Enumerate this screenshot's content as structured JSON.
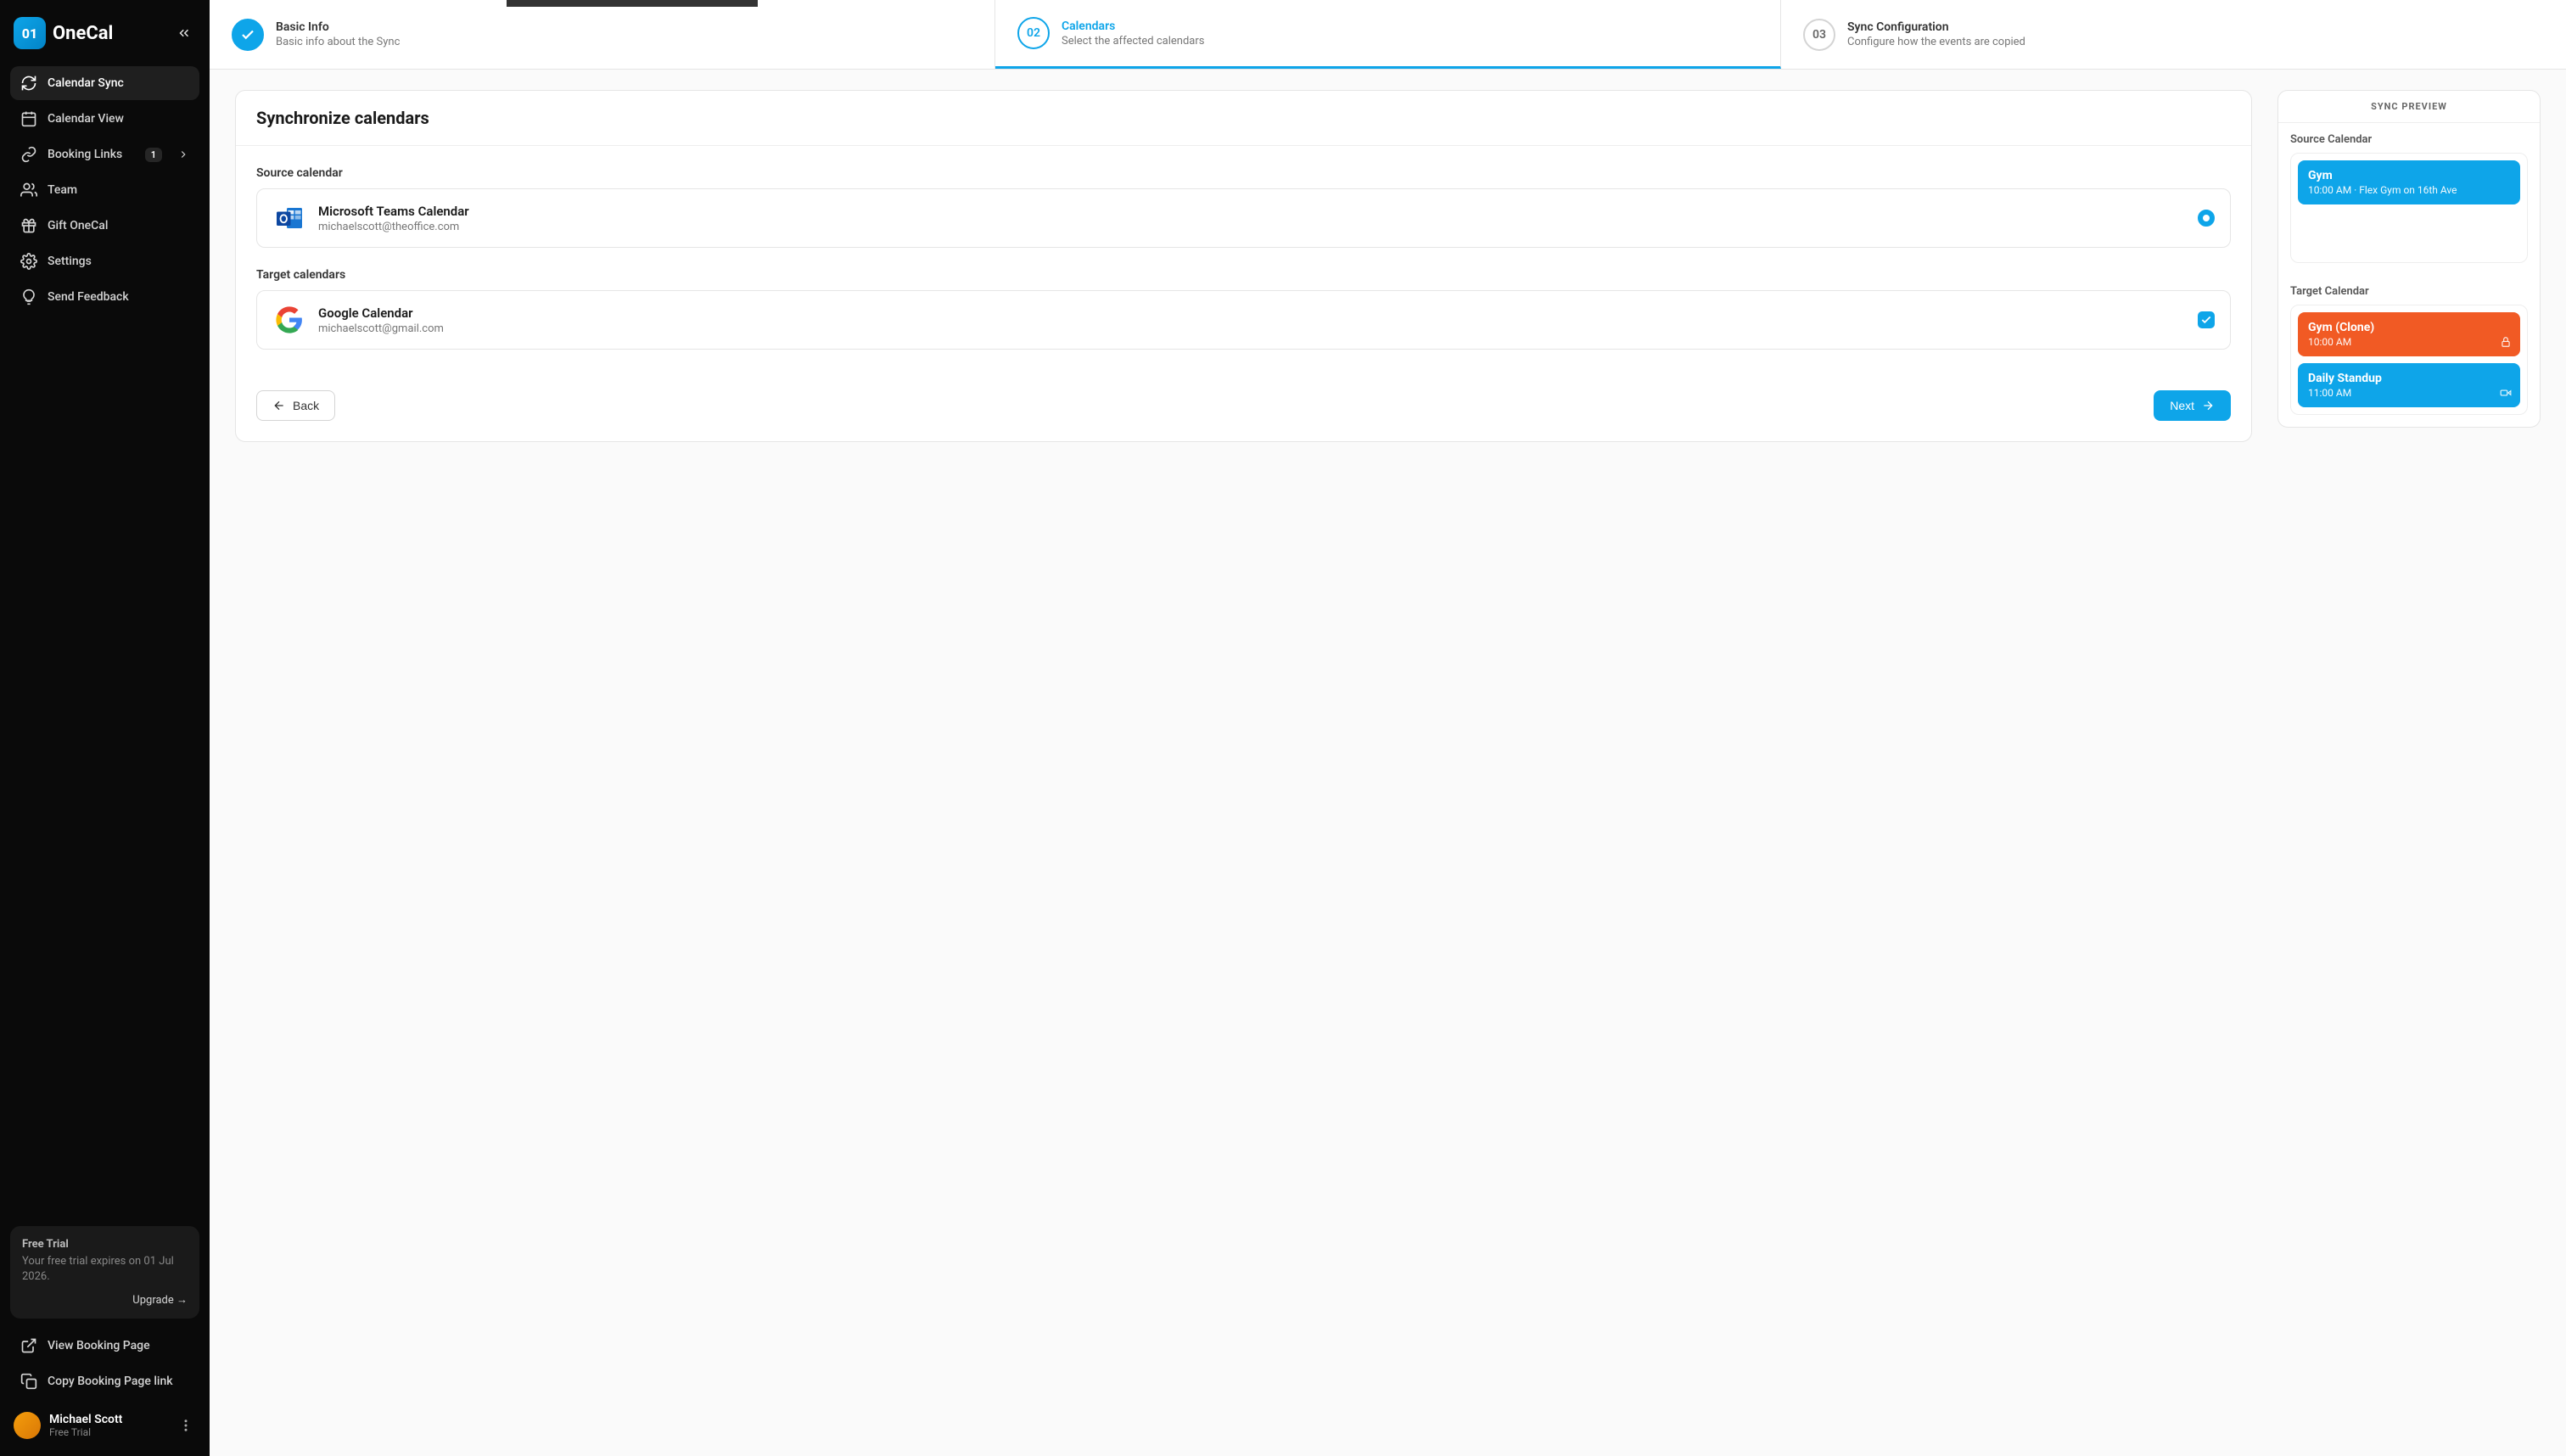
{
  "brand": {
    "badge": "01",
    "name": "OneCal"
  },
  "sidebar": {
    "items": [
      {
        "label": "Calendar Sync"
      },
      {
        "label": "Calendar View"
      },
      {
        "label": "Booking Links",
        "badge": "1"
      },
      {
        "label": "Team"
      },
      {
        "label": "Gift OneCal"
      },
      {
        "label": "Settings"
      },
      {
        "label": "Send Feedback"
      }
    ],
    "trial": {
      "title": "Free Trial",
      "text": "Your free trial expires on 01 Jul 2026.",
      "upgrade": "Upgrade →"
    },
    "bottom": [
      {
        "label": "View Booking Page"
      },
      {
        "label": "Copy Booking Page link"
      }
    ],
    "user": {
      "name": "Michael Scott",
      "plan": "Free Trial"
    }
  },
  "stepper": {
    "steps": [
      {
        "num": "",
        "title": "Basic Info",
        "sub": "Basic info about the Sync"
      },
      {
        "num": "02",
        "title": "Calendars",
        "sub": "Select the affected calendars"
      },
      {
        "num": "03",
        "title": "Sync Configuration",
        "sub": "Configure how the events are copied"
      }
    ]
  },
  "form": {
    "title": "Synchronize calendars",
    "source_label": "Source calendar",
    "source": {
      "name": "Microsoft Teams Calendar",
      "email": "michaelscott@theoffice.com"
    },
    "target_label": "Target calendars",
    "target": {
      "name": "Google Calendar",
      "email": "michaelscott@gmail.com"
    },
    "back": "Back",
    "next": "Next"
  },
  "preview": {
    "header": "SYNC PREVIEW",
    "source_label": "Source Calendar",
    "source_events": [
      {
        "title": "Gym",
        "sub": "10:00 AM · Flex Gym on 16th Ave",
        "color": "ev-blue"
      }
    ],
    "target_label": "Target Calendar",
    "target_events": [
      {
        "title": "Gym (Clone)",
        "sub": "10:00 AM",
        "color": "ev-orange",
        "icon": "lock"
      },
      {
        "title": "Daily Standup",
        "sub": "11:00 AM",
        "color": "ev-blue",
        "icon": "video"
      }
    ]
  }
}
